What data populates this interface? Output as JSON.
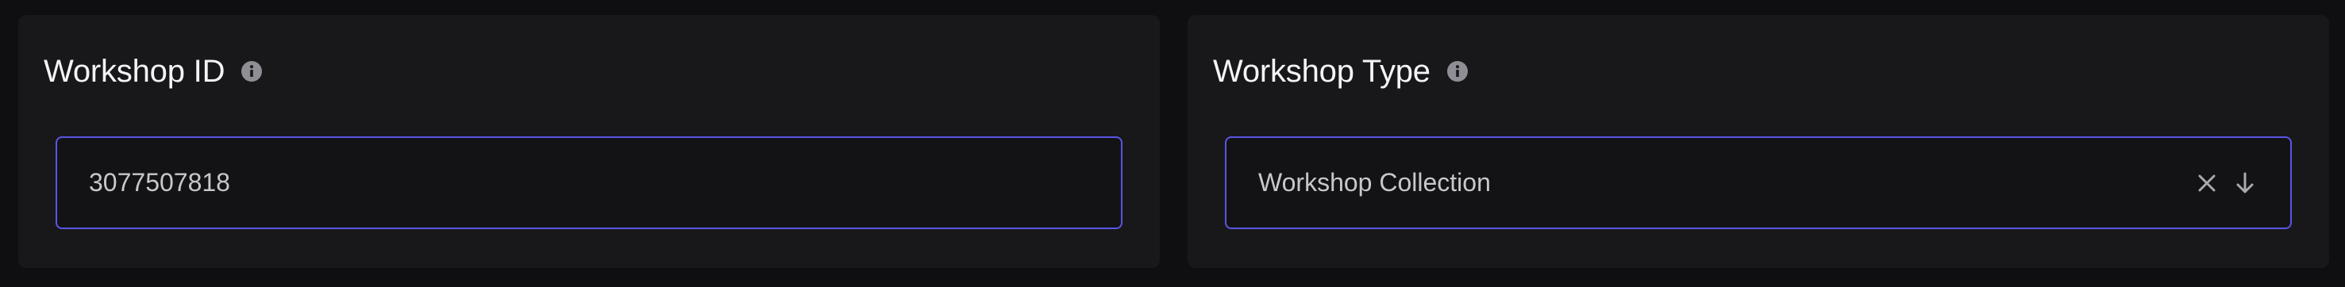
{
  "workshop_id": {
    "title": "Workshop ID",
    "info_icon": "info-icon",
    "value": "3077507818"
  },
  "workshop_type": {
    "title": "Workshop Type",
    "info_icon": "info-icon",
    "selected": "Workshop Collection",
    "clear_icon": "close-icon",
    "dropdown_icon": "arrow-down-icon"
  },
  "colors": {
    "background": "#0f0f11",
    "panel": "#18181b",
    "field_border": "#5b55e6",
    "title_text": "#f4f4f5",
    "field_text": "#c8c8cc"
  }
}
